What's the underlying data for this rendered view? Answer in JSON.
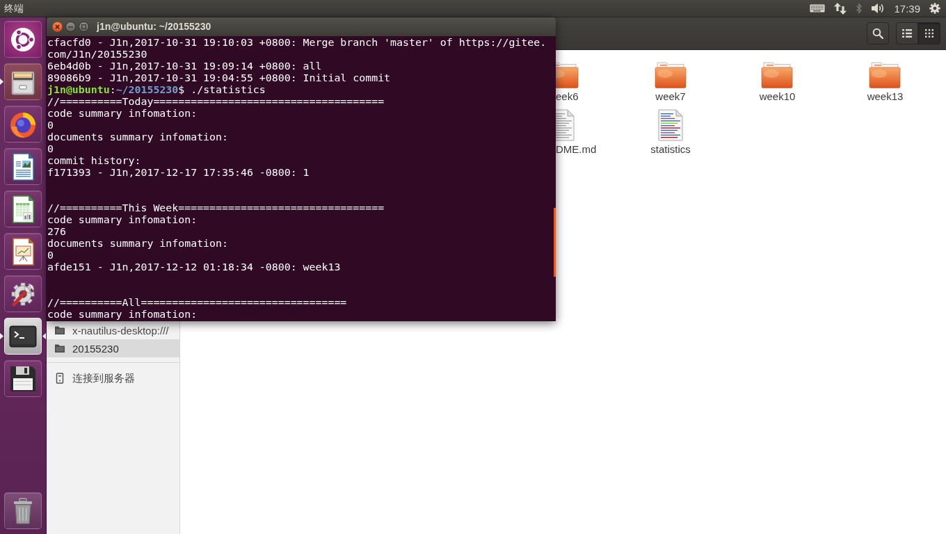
{
  "top_panel": {
    "app_title": "终端",
    "indicators": [
      {
        "kind": "keyboard",
        "disabled": false
      },
      {
        "kind": "network",
        "disabled": false
      },
      {
        "kind": "bluetooth",
        "disabled": true
      },
      {
        "kind": "volume",
        "disabled": false
      }
    ],
    "clock": "17:39"
  },
  "launcher": {
    "items": [
      {
        "kind": "dash",
        "running": false,
        "focused": false
      },
      {
        "kind": "file-cabinet",
        "running": true,
        "focused": false
      },
      {
        "kind": "browser",
        "running": false,
        "focused": false
      },
      {
        "kind": "document",
        "running": false,
        "focused": false
      },
      {
        "kind": "spreadsheet",
        "running": false,
        "focused": false
      },
      {
        "kind": "presentation",
        "running": false,
        "focused": false
      },
      {
        "kind": "settings",
        "running": false,
        "focused": false
      },
      {
        "kind": "terminal",
        "running": true,
        "focused": true
      },
      {
        "kind": "floppy-disk",
        "running": false,
        "focused": false
      }
    ],
    "bottom_items": [
      {
        "kind": "trash",
        "running": false,
        "focused": false
      }
    ]
  },
  "file_manager": {
    "view_buttons": [
      {
        "kind": "list",
        "selected": false
      },
      {
        "kind": "grid",
        "selected": true
      }
    ],
    "sidebar": [
      {
        "kind": "folder",
        "label": "x-nautilus-desktop:///",
        "selected": false
      },
      {
        "kind": "folder",
        "label": "20155230",
        "selected": true
      },
      {
        "kind": "separator"
      },
      {
        "kind": "server",
        "label": "连接到服务器",
        "selected": false
      }
    ],
    "files": [
      {
        "kind": "folder",
        "name": "eek6"
      },
      {
        "kind": "folder",
        "name": "week7"
      },
      {
        "kind": "folder",
        "name": "week10"
      },
      {
        "kind": "folder",
        "name": "week13"
      },
      {
        "kind": "text",
        "name": "DME.md"
      },
      {
        "kind": "script",
        "name": "statistics"
      }
    ]
  },
  "terminal": {
    "title": "j1n@ubuntu: ~/20155230",
    "lines": [
      {
        "kind": "output",
        "text": "cfacfd0 - J1n,2017-10-31 19:10:03 +0800: Merge branch 'master' of https://gitee."
      },
      {
        "kind": "output",
        "text": "com/J1n/20155230"
      },
      {
        "kind": "output",
        "text": "6eb4d0b - J1n,2017-10-31 19:09:14 +0800: all"
      },
      {
        "kind": "output",
        "text": "89086b9 - J1n,2017-10-31 19:04:55 +0800: Initial commit"
      },
      {
        "kind": "prompt",
        "user": "j1n@ubuntu",
        "separator": ":",
        "path": "~/20155230",
        "symbol": "$",
        "command": "./statistics"
      },
      {
        "kind": "output",
        "text": "//==========Today====================================="
      },
      {
        "kind": "output",
        "text": "code summary infomation:"
      },
      {
        "kind": "output",
        "text": "0"
      },
      {
        "kind": "output",
        "text": "documents summary infomation:"
      },
      {
        "kind": "output",
        "text": "0"
      },
      {
        "kind": "output",
        "text": "commit history:"
      },
      {
        "kind": "output",
        "text": "f171393 - J1n,2017-12-17 17:35:46 -0800: 1"
      },
      {
        "kind": "blank"
      },
      {
        "kind": "blank"
      },
      {
        "kind": "output",
        "text": "//==========This Week================================="
      },
      {
        "kind": "output",
        "text": "code summary infomation:"
      },
      {
        "kind": "output",
        "text": "276"
      },
      {
        "kind": "output",
        "text": "documents summary infomation:"
      },
      {
        "kind": "output",
        "text": "0"
      },
      {
        "kind": "output",
        "text": "afde151 - J1n,2017-12-12 01:18:34 -0800: week13"
      },
      {
        "kind": "blank"
      },
      {
        "kind": "blank"
      },
      {
        "kind": "output",
        "text": "//==========All================================="
      },
      {
        "kind": "output",
        "text": "code summary infomation:"
      }
    ]
  }
}
